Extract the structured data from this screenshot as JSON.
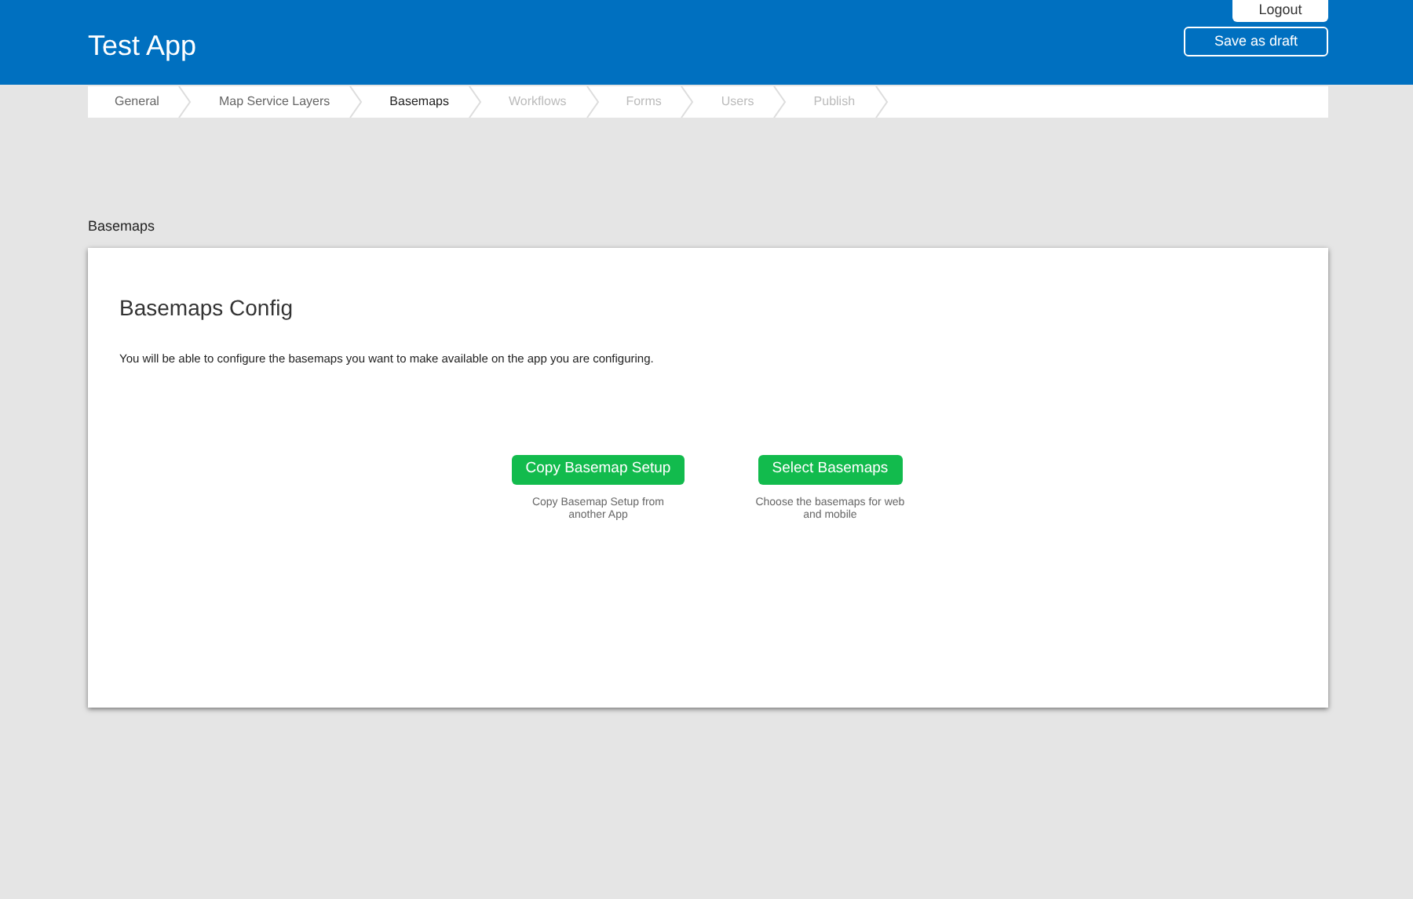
{
  "header": {
    "title": "Test App",
    "logout": "Logout",
    "save": "Save as draft"
  },
  "steps": [
    {
      "label": "General",
      "selected": false,
      "disabled": false
    },
    {
      "label": "Map Service Layers",
      "selected": false,
      "disabled": false
    },
    {
      "label": "Basemaps",
      "selected": true,
      "disabled": false
    },
    {
      "label": "Workflows",
      "selected": false,
      "disabled": true
    },
    {
      "label": "Forms",
      "selected": false,
      "disabled": true
    },
    {
      "label": "Users",
      "selected": false,
      "disabled": true
    },
    {
      "label": "Publish",
      "selected": false,
      "disabled": true
    }
  ],
  "section_title": "Basemaps",
  "card": {
    "title": "Basemaps Config",
    "description": "You will be able to configure the basemaps you want to make available on the app you are configuring.",
    "actions": [
      {
        "button": "Copy Basemap Setup",
        "caption": "Copy Basemap Setup from another App"
      },
      {
        "button": "Select Basemaps",
        "caption": "Choose the basemaps for web and mobile"
      }
    ]
  }
}
